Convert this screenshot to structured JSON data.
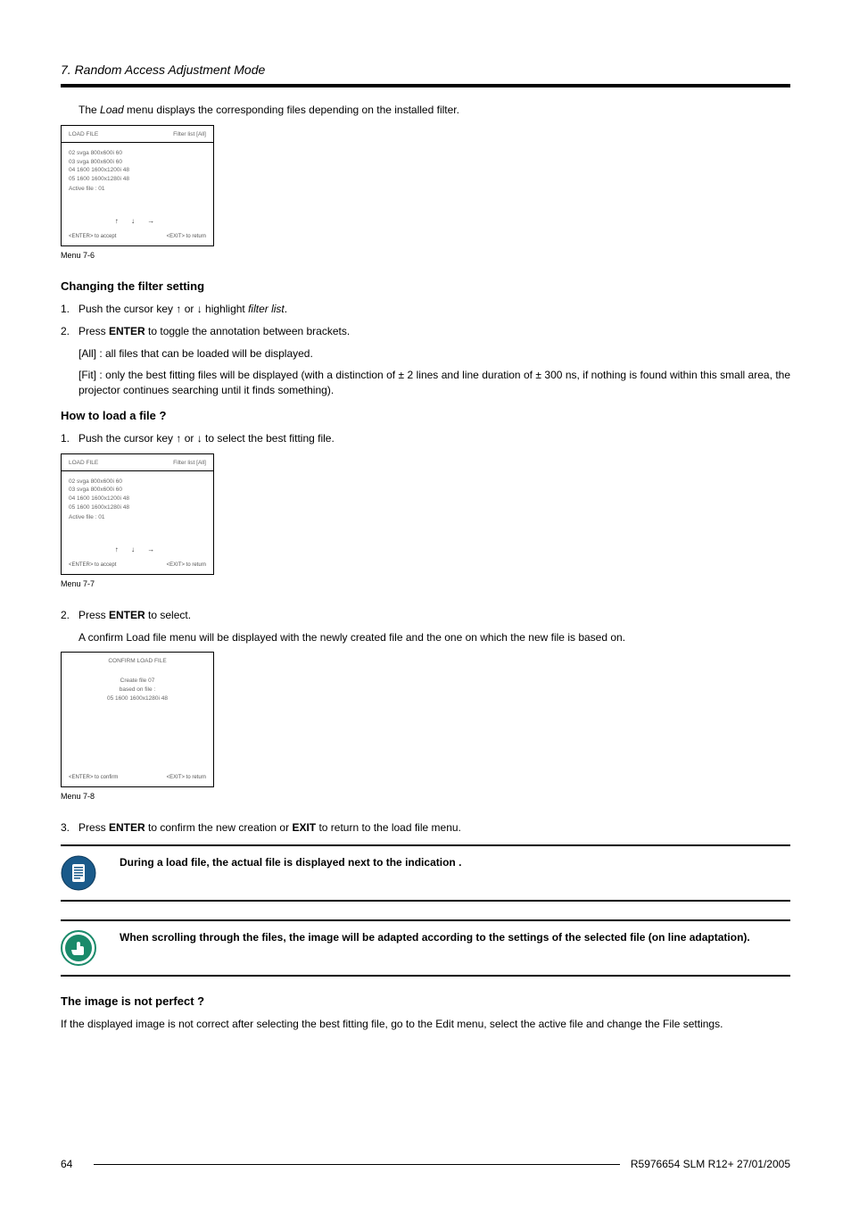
{
  "header": {
    "section": "7. Random Access Adjustment Mode"
  },
  "intro_pre": "The ",
  "intro_em": "Load",
  "intro_post": " menu displays the corresponding files depending on the installed filter.",
  "menu76": {
    "title_left": "LOAD FILE",
    "title_right": "Filter list [All]",
    "lines": [
      "02  svga  800x600i  60",
      "03  svga  800x600i  60",
      "04  1600  1600x1200i  48",
      "05  1600  1600x1280i  48"
    ],
    "nav": "↑    ↓    →",
    "footer_left": "<ENTER> to accept",
    "footer_right": "<EXIT> to return",
    "caption": "Menu 7-6",
    "active": "Active file : 01"
  },
  "h_changing": "Changing the filter setting",
  "step_c1_pre": "Push the cursor key ↑ or ↓ highlight ",
  "step_c1_em": "filter list",
  "step_c1_post": ".",
  "step_c2_pre": "Press ",
  "step_c2_strong": "ENTER",
  "step_c2_post": " to toggle the annotation between brackets.",
  "all_desc": "[All] : all files that can be loaded will be displayed.",
  "fit_desc": "[Fit] : only the best fitting files will be displayed (with a distinction of ± 2 lines and line duration of ± 300 ns, if nothing is found within this small area, the projector continues searching until it finds something).",
  "h_howto": "How to load a file ?",
  "step_h1": "Push the cursor key ↑ or ↓ to select the best fitting file.",
  "menu77": {
    "title_left": "LOAD FILE",
    "title_right": "Filter list [All]",
    "lines": [
      "02  svga  800x600i  60",
      "03  svga  800x600i  60",
      "04  1600  1600x1200i  48",
      "05  1600  1600x1280i  48"
    ],
    "nav": "↑    ↓    →",
    "footer_left": "<ENTER> to accept",
    "footer_right": "<EXIT> to return",
    "caption": "Menu 7-7",
    "active": "Active file : 01"
  },
  "step_h2_pre": "Press ",
  "step_h2_strong": "ENTER",
  "step_h2_post": " to select.",
  "step_h2_desc": "A confirm Load file menu will be displayed with the newly created file and the one on which the new file is based on.",
  "menu78": {
    "title": "CONFIRM LOAD FILE",
    "lines": [
      "Create file 07",
      "based on file :",
      "05  1600  1600x1280i  48"
    ],
    "footer_left": "<ENTER> to confirm",
    "footer_right": "<EXIT> to return",
    "caption": "Menu 7-8"
  },
  "step_h3_pre": "Press ",
  "step_h3_strong1": "ENTER",
  "step_h3_mid": " to confirm the new creation or ",
  "step_h3_strong2": "EXIT",
  "step_h3_post": " to return to the load file menu.",
  "note1": "During a load file, the actual file is displayed next to the indication                           .",
  "note2": "When scrolling through the files, the image will be adapted according to the settings of the selected file (on line adaptation).",
  "h_notperfect": "The image is not perfect ?",
  "notperfect_body": "If the displayed image is not correct after selecting the best fitting file, go to the Edit menu, select the active file and change the File settings.",
  "footer": {
    "page": "64",
    "doc": "R5976654  SLM R12+  27/01/2005"
  }
}
